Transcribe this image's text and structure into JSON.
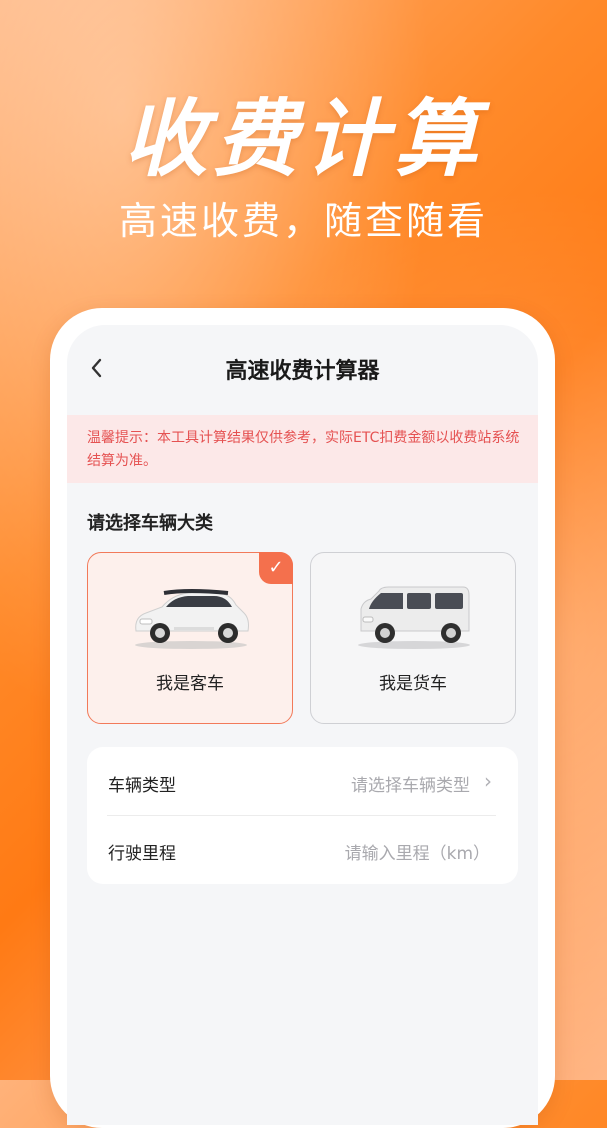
{
  "hero": {
    "title": "收费计算",
    "subtitle": "高速收费，随查随看"
  },
  "nav": {
    "back_icon": "chevron-left-icon",
    "title": "高速收费计算器"
  },
  "notice": {
    "text": "温馨提示：本工具计算结果仅供参考，实际ETC扣费金额以收费站系统结算为准。"
  },
  "vehicle_category": {
    "label": "请选择车辆大类",
    "options": [
      {
        "label": "我是客车",
        "selected": true
      },
      {
        "label": "我是货车",
        "selected": false
      }
    ]
  },
  "form": {
    "vehicle_type": {
      "label": "车辆类型",
      "placeholder": "请选择车辆类型"
    },
    "mileage": {
      "label": "行驶里程",
      "placeholder": "请输入里程（km）"
    }
  },
  "colors": {
    "accent": "#f4704d",
    "notice_text": "#e55252",
    "notice_bg": "#fce8e8",
    "background_orange": "#ff7a14"
  }
}
